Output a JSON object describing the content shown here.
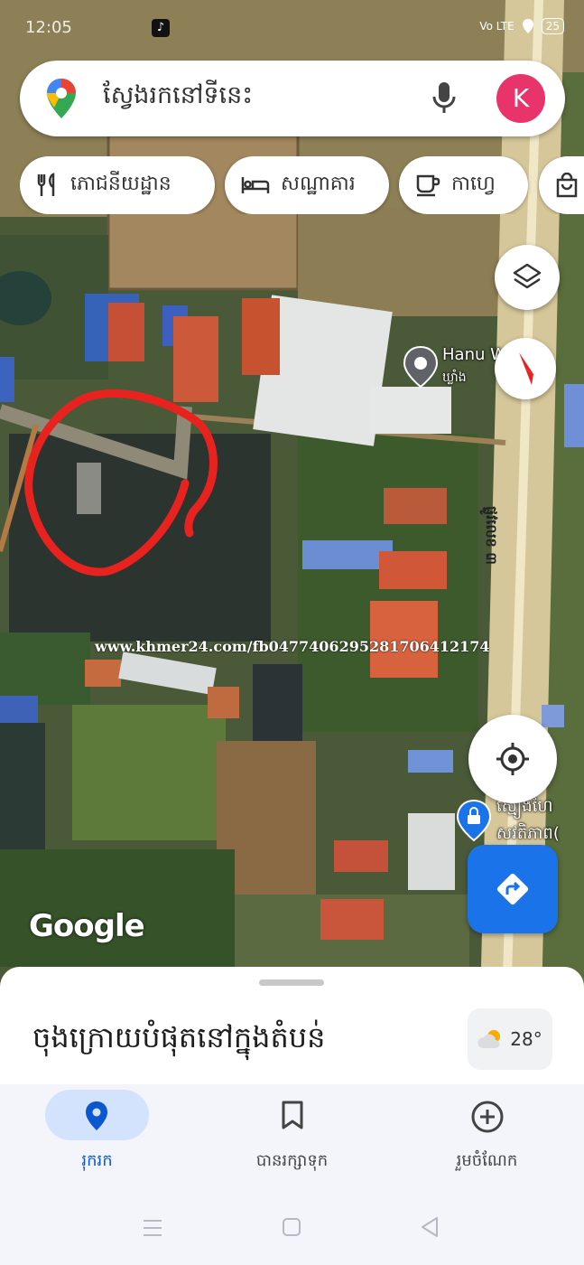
{
  "status_bar": {
    "time": "12:05",
    "tiktok": "♪",
    "network": "Vo LTE",
    "battery": "25"
  },
  "search": {
    "placeholder": "ស្វែងរកនៅទីនេះ",
    "avatar_letter": "K"
  },
  "chips": [
    {
      "label": "ភោជនីយដ្ឋាន",
      "icon": "restaurant-icon"
    },
    {
      "label": "សណ្ឋាគារ",
      "icon": "hotel-icon"
    },
    {
      "label": "កាហ្វេ",
      "icon": "coffee-icon"
    },
    {
      "label": "",
      "icon": "shopping-icon"
    }
  ],
  "map": {
    "poi_hanuman": "Hanu     WH",
    "poi_hanuman_sub": "ឃ្លាំង",
    "road_name": "ផ្លូវលេខ ៣",
    "poi_security_1": "ស្មៀងហៃ",
    "poi_security_2": "សវតិភាព(",
    "watermark": "www.khmer24.com/fb0477406295281706412174",
    "google_logo": "Google"
  },
  "bottom_sheet": {
    "title": "ចុងក្រោយបំផុតនៅក្នុងតំបន់",
    "temperature": "28°"
  },
  "nav": [
    {
      "label": "រុករក",
      "icon": "location-pin-icon",
      "active": true
    },
    {
      "label": "បានរក្សាទុក",
      "icon": "bookmark-icon",
      "active": false
    },
    {
      "label": "រួមចំណែក",
      "icon": "add-circle-icon",
      "active": false
    }
  ],
  "colors": {
    "accent": "#1a73e8",
    "avatar": "#e8336b",
    "annotation": "#e8231f"
  }
}
